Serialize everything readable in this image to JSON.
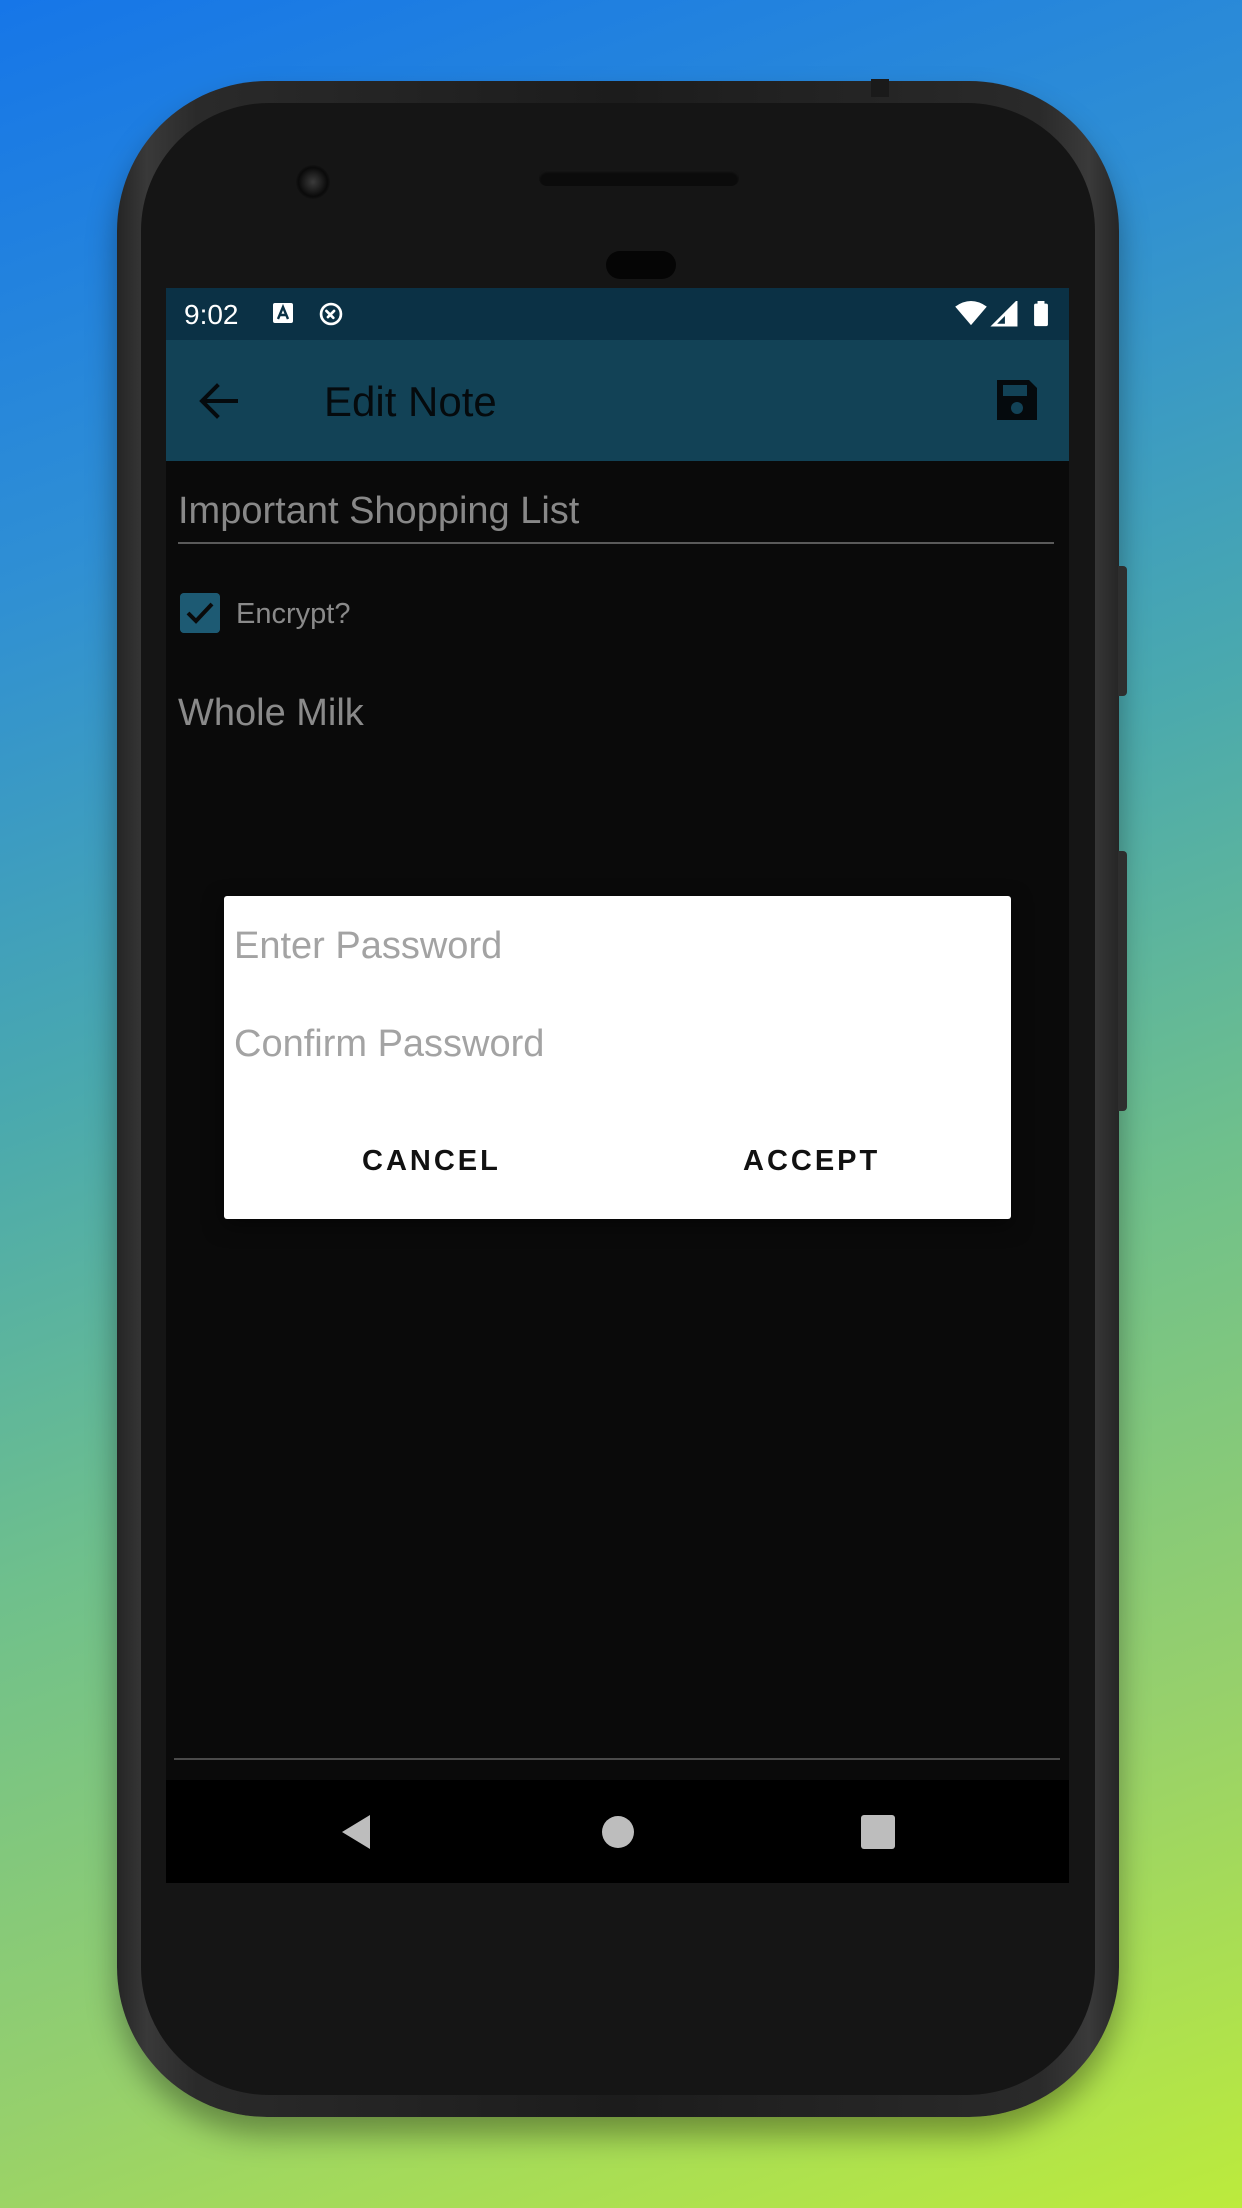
{
  "status_bar": {
    "time": "9:02",
    "icons": [
      "keyboard-a-icon",
      "sync-circle-icon",
      "wifi-icon",
      "cell-signal-icon",
      "battery-icon"
    ]
  },
  "app_bar": {
    "title": "Edit Note",
    "back_icon": "arrow-left-icon",
    "save_icon": "floppy-disk-icon"
  },
  "note": {
    "title": "Important Shopping List",
    "encrypt_label": "Encrypt?",
    "encrypt_checked": true,
    "body": "Whole Milk"
  },
  "dialog": {
    "password_placeholder": "Enter Password",
    "confirm_placeholder": "Confirm Password",
    "cancel_label": "CANCEL",
    "accept_label": "ACCEPT"
  },
  "nav_bar": {
    "icons": [
      "back-triangle-icon",
      "home-circle-icon",
      "recents-square-icon"
    ]
  },
  "colors": {
    "status_bar": "#0b3145",
    "app_bar": "#124256",
    "screen_background": "#0a0a0a",
    "checkbox": "#1d5a73",
    "dialog": "#ffffff"
  }
}
